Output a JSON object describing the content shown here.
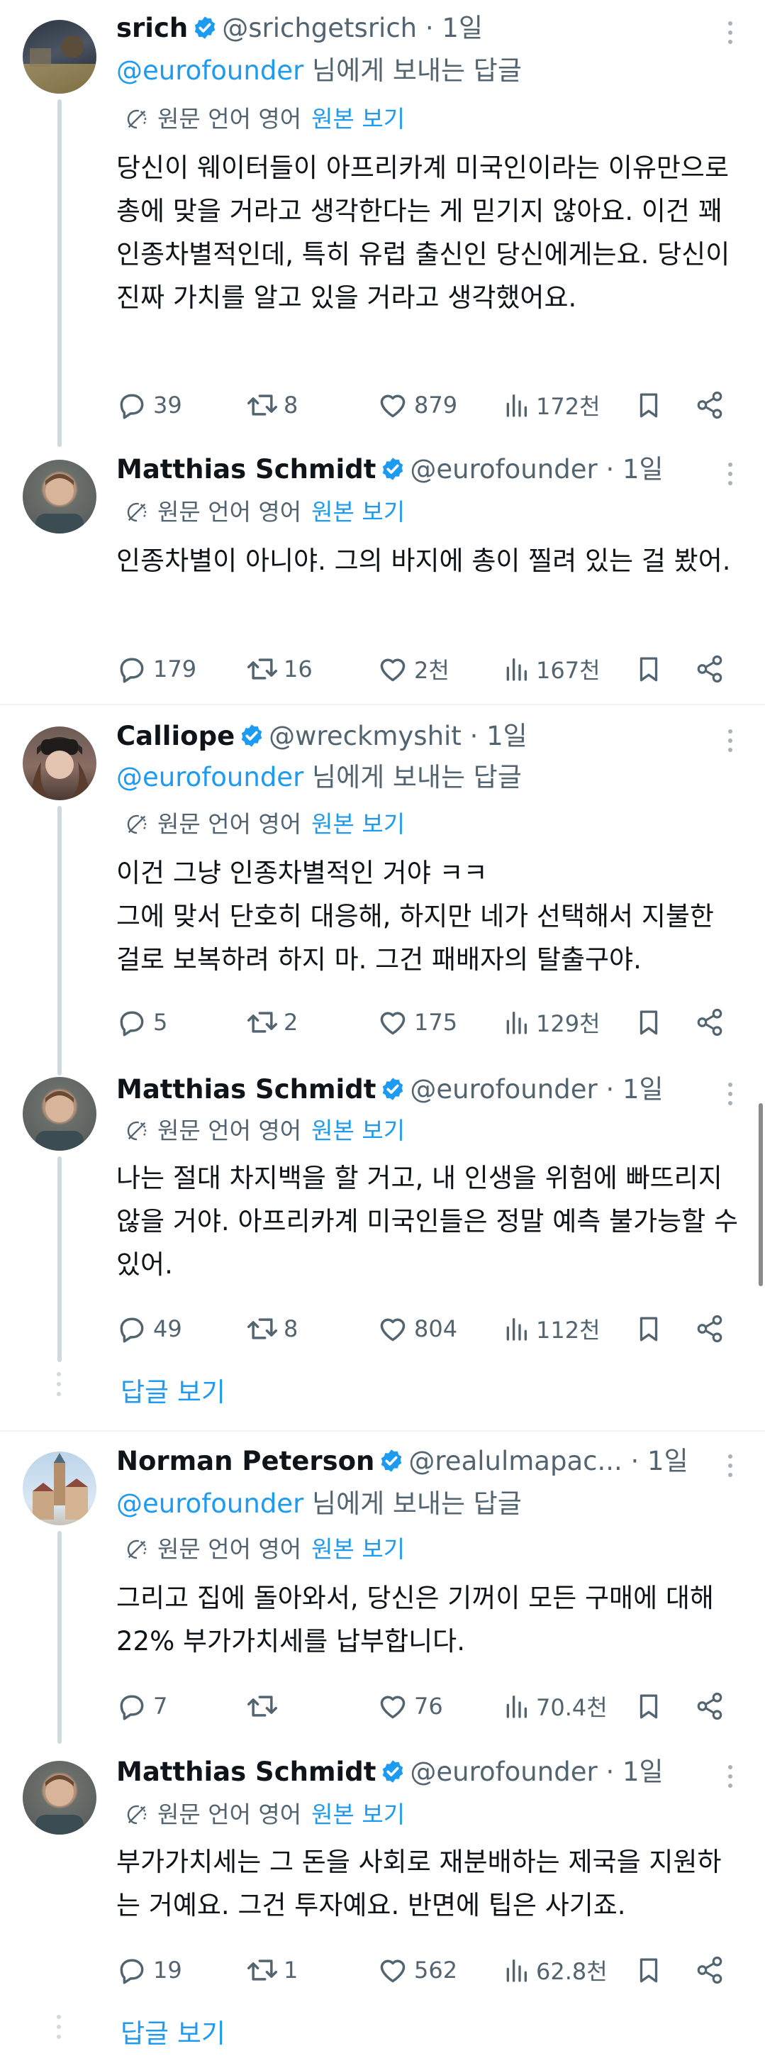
{
  "translate": {
    "label": "원문 언어 영어",
    "link": "원본 보기"
  },
  "reply_prefix": "@eurofounder",
  "reply_suffix": " 님에게 보내는 답글",
  "show_replies": "답글 보기",
  "tweets": [
    {
      "name": "srich",
      "handle": "@srichgetsrich",
      "time": "· 1일",
      "body": "당신이 웨이터들이 아프리카계 미국인이라는 이유만으로 총에 맞을 거라고 생각한다는 게 믿기지 않아요. 이건 꽤 인종차별적인데, 특히 유럽 출신인 당신에게는요. 당신이 진짜 가치를 알고 있을 거라고 생각했어요.",
      "replies": "39",
      "retweets": "8",
      "likes": "879",
      "views": "172천"
    },
    {
      "name": "Matthias Schmidt",
      "handle": "@eurofounder",
      "time": "· 1일",
      "body": "인종차별이 아니야. 그의 바지에 총이 찔려 있는 걸 봤어.",
      "replies": "179",
      "retweets": "16",
      "likes": "2천",
      "views": "167천"
    },
    {
      "name": "Calliope",
      "handle": "@wreckmyshit",
      "time": "· 1일",
      "body": "이건 그냥 인종차별적인 거야 ㅋㅋ\n그에 맞서 단호히 대응해, 하지만 네가 선택해서 지불한 걸로 보복하려 하지 마. 그건 패배자의 탈출구야.",
      "replies": "5",
      "retweets": "2",
      "likes": "175",
      "views": "129천"
    },
    {
      "name": "Matthias Schmidt",
      "handle": "@eurofounder",
      "time": "· 1일",
      "body": "나는 절대 차지백을 할 거고, 내 인생을 위험에 빠뜨리지 않을 거야. 아프리카계 미국인들은 정말 예측 불가능할 수 있어.",
      "replies": "49",
      "retweets": "8",
      "likes": "804",
      "views": "112천"
    },
    {
      "name": "Norman Peterson",
      "handle": "@realulmapac...",
      "time": "· 1일",
      "body": "그리고 집에 돌아와서, 당신은 기꺼이 모든 구매에 대해 22% 부가가치세를 납부합니다.",
      "replies": "7",
      "retweets": "",
      "likes": "76",
      "views": "70.4천"
    },
    {
      "name": "Matthias Schmidt",
      "handle": "@eurofounder",
      "time": "· 1일",
      "body": "부가가치세는 그 돈을 사회로 재분배하는 제국을 지원하는 거예요. 그건 투자예요. 반면에 팁은 사기죠.",
      "replies": "19",
      "retweets": "1",
      "likes": "562",
      "views": "62.8천"
    }
  ],
  "colors": {
    "accent": "#1d9bf0",
    "secondary_text": "#536471",
    "thread_line": "#cfd9de"
  }
}
